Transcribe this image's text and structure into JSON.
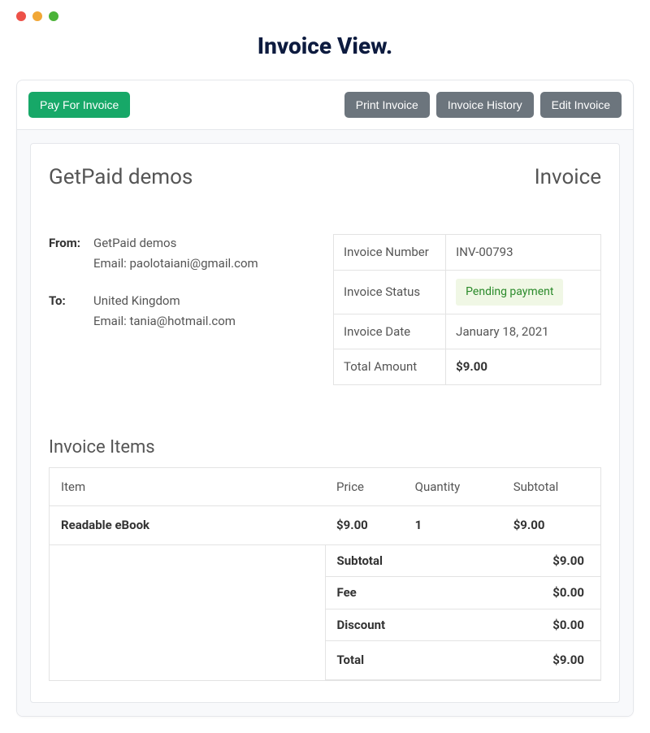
{
  "page": {
    "title": "Invoice View."
  },
  "toolbar": {
    "pay_label": "Pay For Invoice",
    "print_label": "Print Invoice",
    "history_label": "Invoice History",
    "edit_label": "Edit Invoice"
  },
  "sheet": {
    "brand": "GetPaid demos",
    "doc_label": "Invoice"
  },
  "address": {
    "from_label": "From:",
    "from_name": "GetPaid demos",
    "from_email": "Email: paolotaiani@gmail.com",
    "to_label": "To:",
    "to_name": "United Kingdom",
    "to_email": "Email: tania@hotmail.com"
  },
  "meta": {
    "number_label": "Invoice Number",
    "number_value": "INV-00793",
    "status_label": "Invoice Status",
    "status_value": "Pending payment",
    "date_label": "Invoice Date",
    "date_value": "January 18, 2021",
    "total_label": "Total Amount",
    "total_value": "$9.00"
  },
  "items": {
    "title": "Invoice Items",
    "headers": {
      "item": "Item",
      "price": "Price",
      "qty": "Quantity",
      "subtotal": "Subtotal"
    },
    "rows": [
      {
        "name": "Readable eBook",
        "price": "$9.00",
        "qty": "1",
        "subtotal": "$9.00"
      }
    ],
    "summary": {
      "subtotal_label": "Subtotal",
      "subtotal_value": "$9.00",
      "fee_label": "Fee",
      "fee_value": "$0.00",
      "discount_label": "Discount",
      "discount_value": "$0.00",
      "total_label": "Total",
      "total_value": "$9.00"
    }
  }
}
